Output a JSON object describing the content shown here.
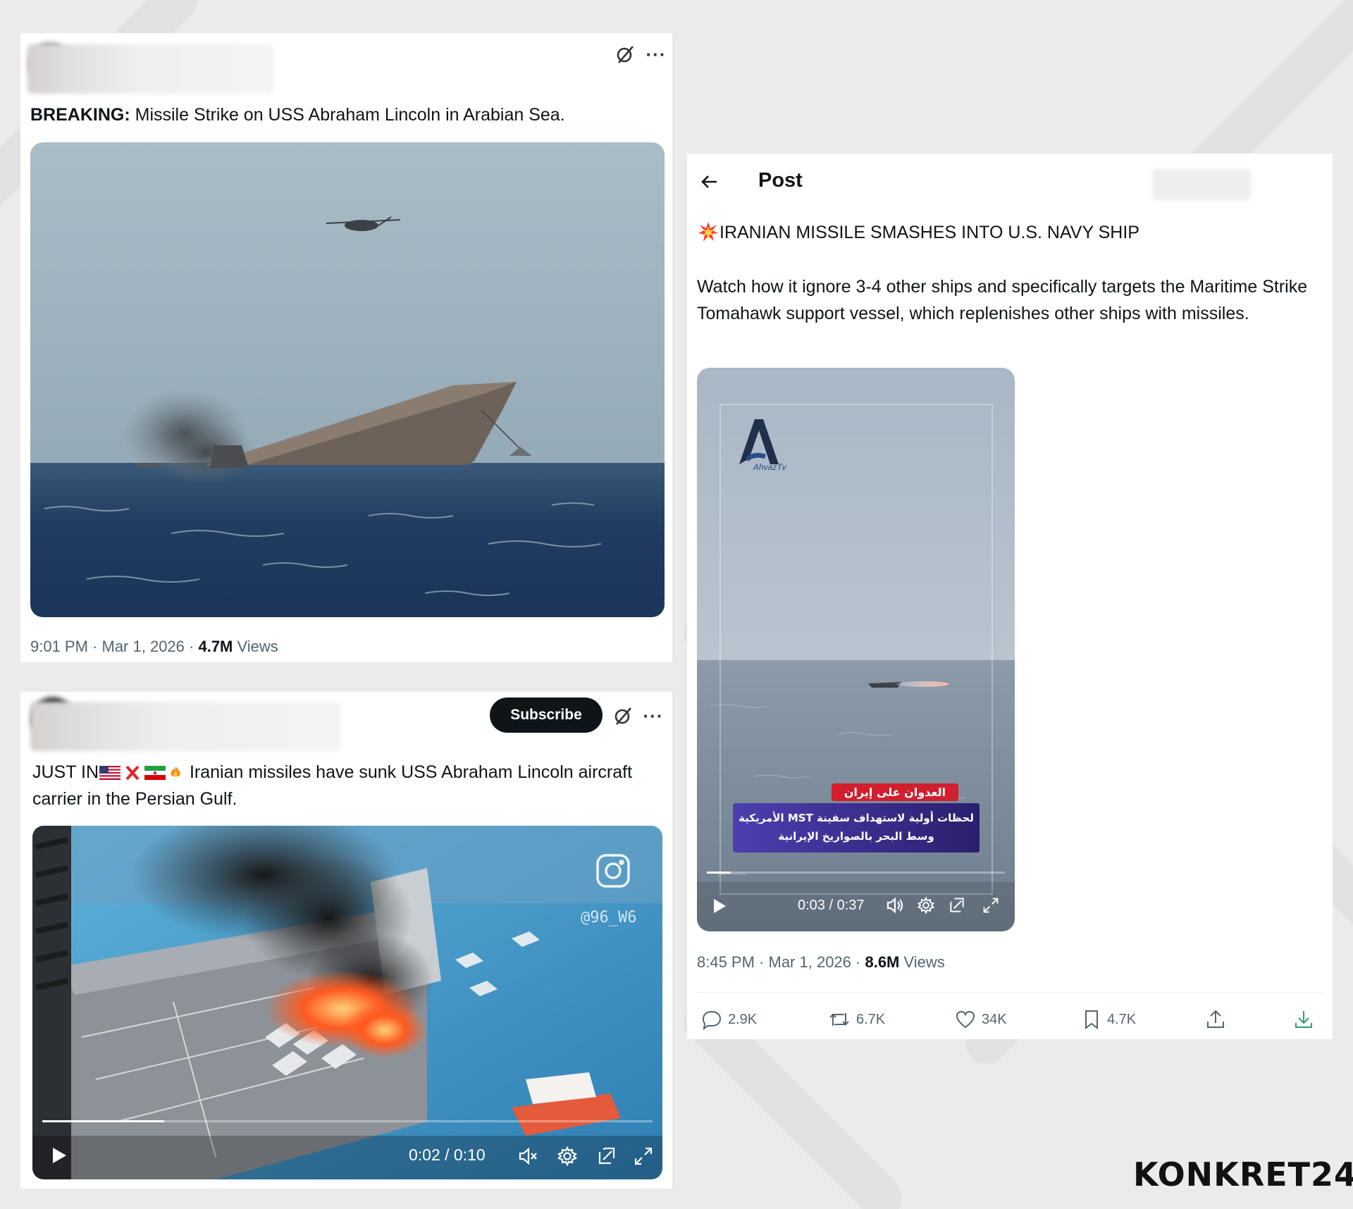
{
  "post1": {
    "label": "BREAKING:",
    "text": " Missile Strike on USS Abraham Lincoln in Arabian Sea.",
    "time": "9:01 PM",
    "sep1": " · ",
    "date": "Mar 1, 2026",
    "sep2": " · ",
    "views_count": "4.7M",
    "views_label": " Views"
  },
  "post2": {
    "subscribe_label": "Subscribe",
    "prefix": "JUST IN",
    "text": " Iranian missiles have sunk USS Abraham Lincoln aircraft carrier in the Persian Gulf.",
    "watermark": "@96_W6",
    "player_time": "0:02 / 0:10",
    "progress": 0.2
  },
  "post3": {
    "header_title": "Post",
    "headline": "IRANIAN MISSILE SMASHES INTO U.S. NAVY SHIP",
    "body": "Watch how it ignore 3-4 other ships and specifically targets the Maritime Strike Tomahawk support vessel, which replenishes other ships with missiles.",
    "video_logo_text": "AhvazTv",
    "overlay_tag": "العدوان على إيران",
    "overlay_line1": "لحظات أولية لاستهداف سفينة MST الأمريكية",
    "overlay_line2": "وسط البحر بالصواريخ الإيرانية",
    "player_time": "0:03 / 0:37",
    "progress": 0.08,
    "time": "8:45 PM",
    "sep1": " · ",
    "date": "Mar 1, 2026",
    "sep2": " · ",
    "views_count": "8.6M",
    "views_label": " Views",
    "replies": "2.9K",
    "reposts": "6.7K",
    "likes": "34K",
    "bookmarks": "4.7K"
  },
  "brand": {
    "name": "KONKRET24"
  },
  "colors": {
    "sky": "#9fb3bf",
    "sea": "#1f3d63",
    "fire": "#ff5a1f",
    "overlay_red": "#d11f2e",
    "overlay_navy": "#2a1f6e",
    "download_green": "#2f9e6a"
  }
}
